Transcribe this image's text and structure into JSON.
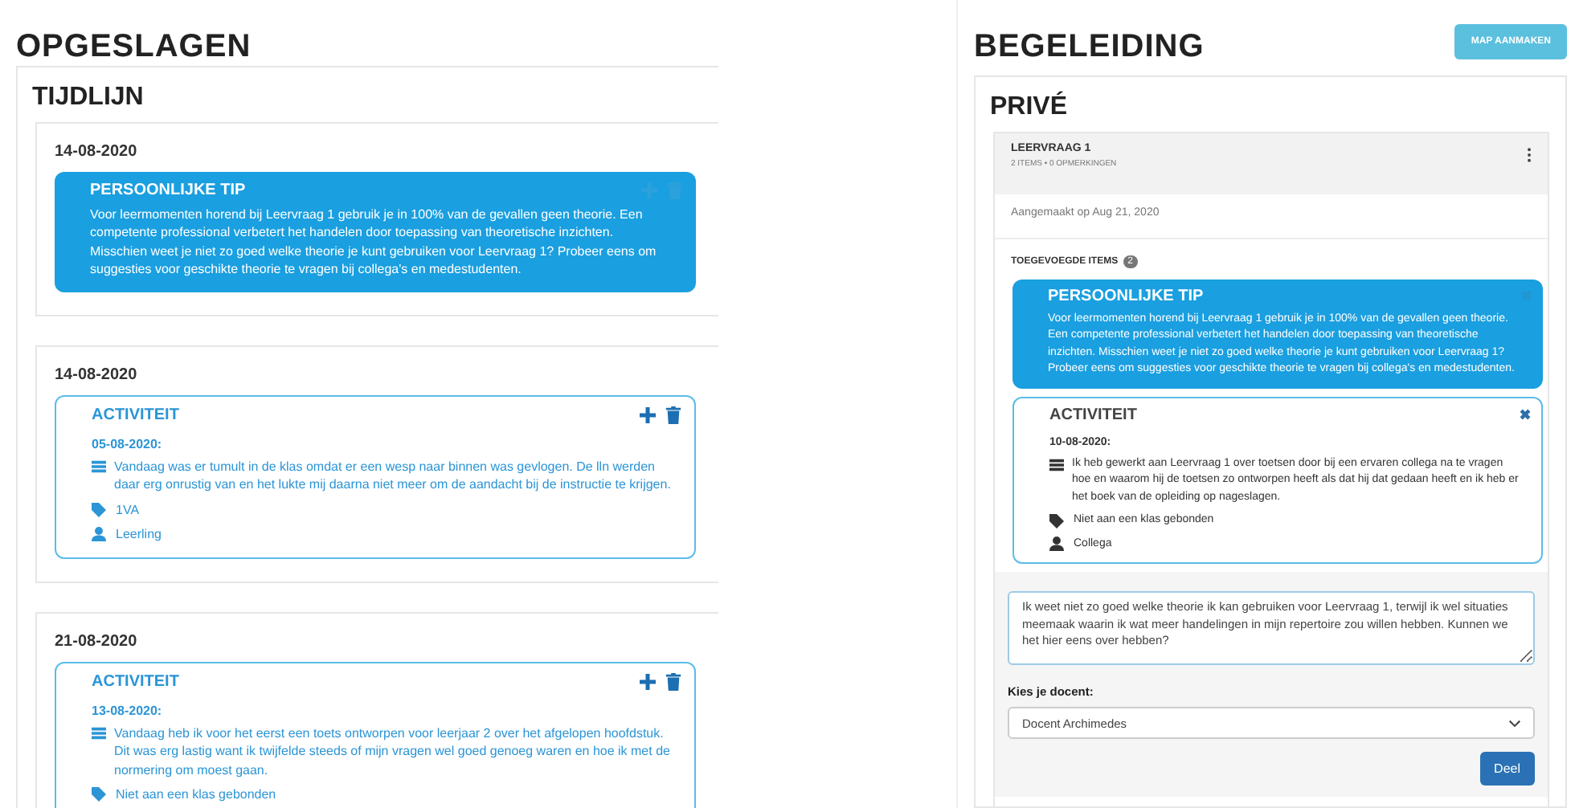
{
  "saved": {
    "title": "OPGESLAGEN",
    "panel_title": "TIJDLIJN",
    "entries": [
      {
        "date": "14-08-2020",
        "items": [
          {
            "kind": "tip",
            "title": "PERSOONLIJKE TIP",
            "text": "Voor leermomenten horend bij Leervraag 1 gebruik je in 100% van de gevallen geen theorie. Een competente professional verbetert het handelen door toepassing van theoretische inzichten. Misschien weet je niet zo goed welke theorie je kunt gebruiken voor Leervraag 1? Probeer eens om suggesties voor geschikte theorie te vragen bij collega's en medestudenten."
          }
        ]
      },
      {
        "date": "14-08-2020",
        "items": [
          {
            "kind": "activity",
            "title": "ACTIVITEIT",
            "date": "05-08-2020:",
            "text": "Vandaag was er tumult in de klas omdat er een wesp naar binnen was gevlogen. De lln werden daar erg onrustig van en het lukte mij daarna niet meer om de aandacht bij de instructie te krijgen.",
            "tag": "1VA",
            "person": "Leerling"
          }
        ]
      },
      {
        "date": "21-08-2020",
        "items": [
          {
            "kind": "activity",
            "title": "ACTIVITEIT",
            "date": "13-08-2020:",
            "text": "Vandaag heb ik voor het eerst een toets ontworpen voor leerjaar 2 over het afgelopen hoofdstuk. Dit was erg lastig want ik twijfelde steeds of mijn vragen wel goed genoeg waren en hoe ik met de normering om moest gaan.",
            "tag": "Niet aan een klas gebonden"
          }
        ]
      }
    ]
  },
  "guidance": {
    "title": "BEGELEIDING",
    "button": "MAP AANMAKEN",
    "panel_title": "PRIVÉ",
    "folder": {
      "name": "LEERVRAAG 1",
      "meta": "2 ITEMS • 0 OPMERKINGEN",
      "created": "Aangemaakt op Aug 21, 2020",
      "added_label": "TOEGEVOEGDE ITEMS",
      "added_count": "2",
      "items": [
        {
          "kind": "tip",
          "title": "PERSOONLIJKE TIP",
          "text": "Voor leermomenten horend bij Leervraag 1 gebruik je in 100% van de gevallen geen theorie. Een competente professional verbetert het handelen door toepassing van theoretische inzichten. Misschien weet je niet zo goed welke theorie je kunt gebruiken voor Leervraag 1? Probeer eens om suggesties voor geschikte theorie te vragen bij collega's en medestudenten."
        },
        {
          "kind": "activity",
          "title": "ACTIVITEIT",
          "date": "10-08-2020:",
          "text": "Ik heb gewerkt aan Leervraag 1 over toetsen door bij een ervaren collega na te vragen hoe en waarom hij de toetsen zo ontworpen heeft als dat hij dat gedaan heeft en ik heb er het boek van de opleiding op nageslagen.",
          "tag": "Niet aan een klas gebonden",
          "person": "Collega"
        }
      ],
      "message": "Ik weet niet zo goed welke theorie ik kan gebruiken voor Leervraag 1, terwijl ik wel situaties meemaak waarin ik wat meer handelingen in mijn repertoire zou willen hebben. Kunnen we het hier eens over hebben?",
      "teacher_label": "Kies je docent:",
      "teacher": "Docent Archimedes",
      "share": "Deel"
    }
  }
}
